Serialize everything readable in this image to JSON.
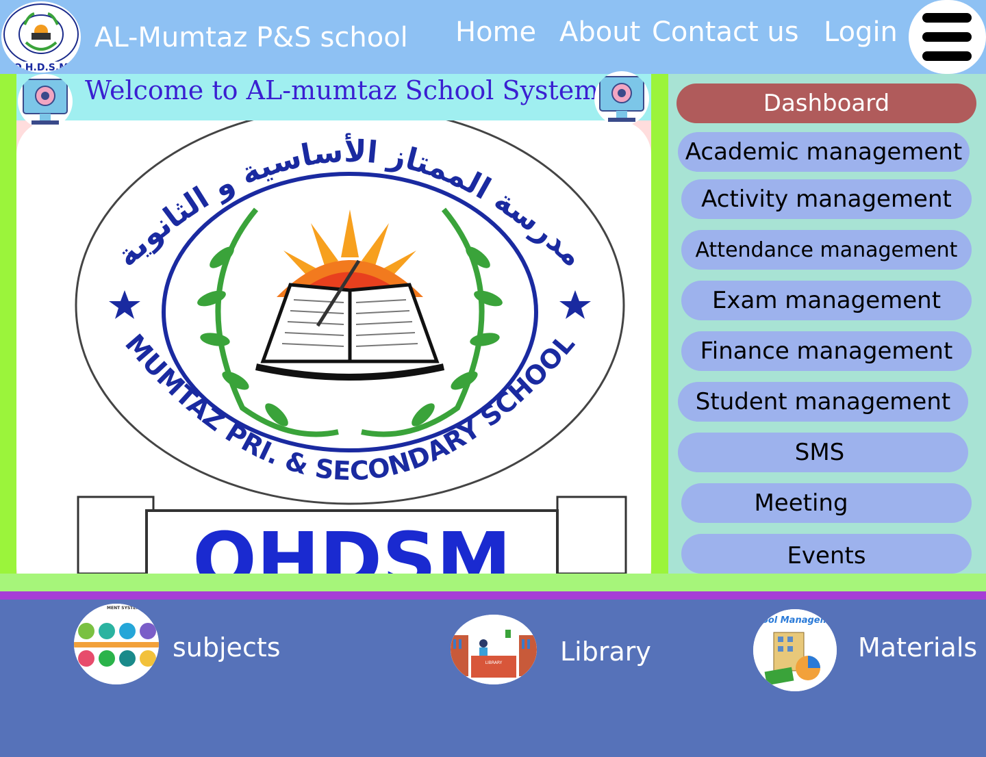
{
  "header": {
    "site_title": "AL-Mumtaz P&S school",
    "logo_text": "O.H.D.S.M",
    "nav": {
      "home": "Home",
      "about": "About",
      "contact": "Contact us",
      "login": "Login"
    }
  },
  "welcome": {
    "text": "Welcome to AL-mumtaz School System"
  },
  "logo": {
    "arabic_text": "مدرسة الممتاز الأساسية و الثانوية",
    "english_text": "MUMTAZ PRI. & SECONDARY SCHOOL",
    "banner_text": "OHDSM"
  },
  "sidebar": {
    "items": [
      {
        "label": "Dashboard"
      },
      {
        "label": "Academic management"
      },
      {
        "label": "Activity management"
      },
      {
        "label": "Attendance management"
      },
      {
        "label": "Exam management"
      },
      {
        "label": "Finance management"
      },
      {
        "label": "Student management"
      },
      {
        "label": "SMS"
      },
      {
        "label": "Meeting"
      },
      {
        "label": "Events"
      }
    ]
  },
  "cards": [
    {
      "label": "subjects",
      "image_caption": "MENT SYSTEM"
    },
    {
      "label": "Library",
      "image_caption": "LIBRARY"
    },
    {
      "label": "Materials",
      "image_caption": "School Management"
    }
  ],
  "colors": {
    "header_bg": "#8ec1f3",
    "panel_green": "#9bf43b",
    "sidebar_bg": "#a8e3d4",
    "button_bg": "#9db2ed",
    "active_button": "#b05b5b",
    "footer_bg": "#5672b9",
    "welcome_text": "#3a1fd1"
  }
}
